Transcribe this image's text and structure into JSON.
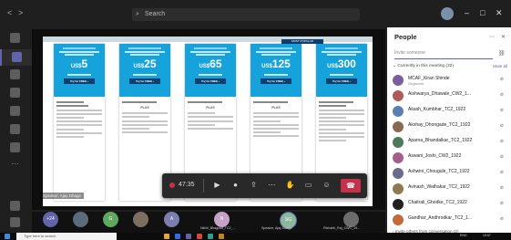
{
  "titlebar": {
    "back": "<",
    "forward": ">",
    "search_placeholder": "Search",
    "minimize": "–",
    "maximize": "□",
    "close": "✕"
  },
  "stage": {
    "speaker": "Speaker, Ajay Dhage",
    "popular_label": "MOST POPULAR",
    "plans": [
      {
        "currency": "US$",
        "price": "5",
        "try": "Try for FREE ›"
      },
      {
        "currency": "US$",
        "price": "25",
        "try": "Try for FREE ›"
      },
      {
        "currency": "US$",
        "price": "65",
        "try": "Try for FREE ›"
      },
      {
        "currency": "US$",
        "price": "125",
        "try": "Try for FREE ›"
      },
      {
        "currency": "US$",
        "price": "300",
        "try": "Try for FREE ›"
      }
    ],
    "plus": "PLUS"
  },
  "controls": {
    "timer": "47:35"
  },
  "people": {
    "title": "People",
    "invite_placeholder": "Invite someone",
    "section": "⌄ Currently in this meeting (32)",
    "mute_all": "Mute all",
    "list": [
      {
        "name": "MCAF_Kiran Shinde",
        "role": "Organizer",
        "color": "#7b5e9b"
      },
      {
        "name": "Aishwarya_Dhawale_CW2_1...",
        "role": "",
        "color": "#b05b5b"
      },
      {
        "name": "Akash_Kumbhar_TC2_1922",
        "role": "",
        "color": "#5b7fb0"
      },
      {
        "name": "Akshay_Dhongade_TC2_1922",
        "role": "",
        "color": "#8a6a4e"
      },
      {
        "name": "Aparna_Bhandalkar_TC2_1922",
        "role": "",
        "color": "#4d7a5c"
      },
      {
        "name": "Aswani_Joshi_CW2_1922",
        "role": "",
        "color": "#a65f8a"
      },
      {
        "name": "Ashwini_Chougule_TC2_1922",
        "role": "",
        "color": "#6b6b8f"
      },
      {
        "name": "Avinash_Wathakar_TC2_1922",
        "role": "",
        "color": "#8f7a4e"
      },
      {
        "name": "Chaitrali_Ghodke_TC2_1922",
        "role": "",
        "color": "#222222"
      },
      {
        "name": "Gandhar_Andhrodkar_TC2_1...",
        "role": "",
        "color": "#c46a3a"
      }
    ],
    "invite_conversation": "› Invite others from conversation (2)"
  },
  "gallery": {
    "plus_count": "+24",
    "tiles": [
      {
        "initials": "",
        "color": "#5a6b7c"
      },
      {
        "initials": "G",
        "color": "#5fa85f"
      },
      {
        "initials": "",
        "color": "#7c6f62"
      },
      {
        "initials": "A",
        "color": "#7d7db0"
      },
      {
        "initials": "N",
        "color": "#c6a2c8"
      },
      {
        "initials": "SG",
        "color": "#8ab89a"
      },
      {
        "initials": "",
        "color": "#6c6c6c"
      }
    ],
    "names": [
      "Nikhil_Bhagwat_TC2_...",
      "Speaker, Ajay Dhage",
      "Rishabh_Raj_CWC_19..."
    ]
  },
  "taskbar": {
    "search": "Type here to search",
    "lang": "ENG",
    "time": "10:07"
  }
}
